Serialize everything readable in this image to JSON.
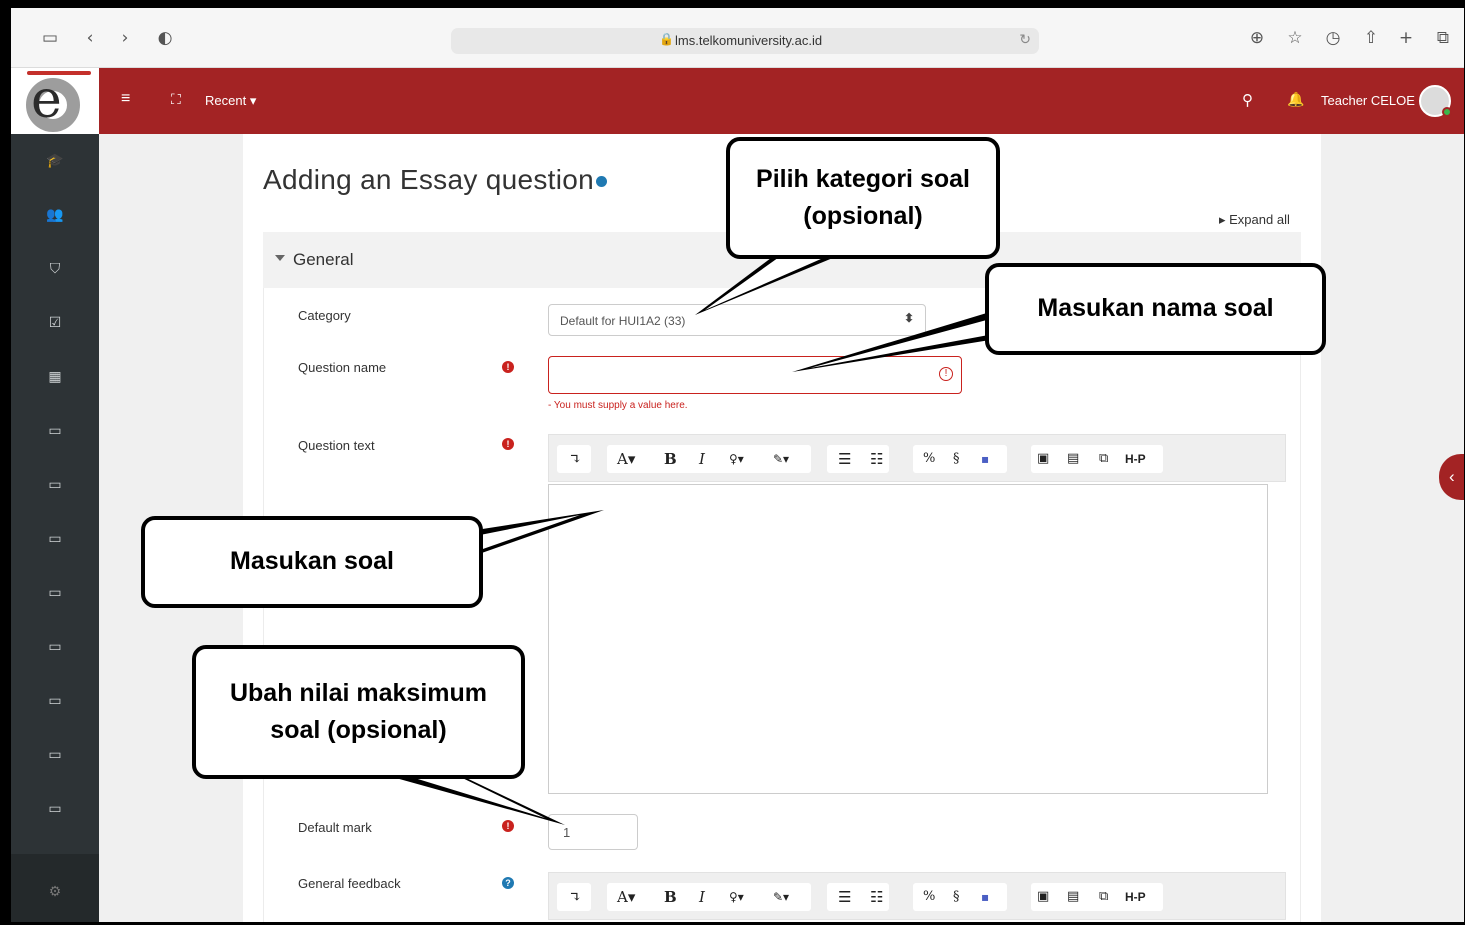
{
  "browser": {
    "url": "lms.telkomuniversity.ac.id",
    "icons": [
      "sidebar-icon",
      "back-icon",
      "forward-icon",
      "shield-icon",
      "download-icon",
      "star-icon",
      "history-icon",
      "share-icon",
      "new-tab-icon",
      "tabs-icon"
    ]
  },
  "navbar": {
    "recent_label": "Recent",
    "user_name": "Teacher CELOE",
    "color": "#a32324"
  },
  "sidebar": {
    "items": [
      "graduation-cap-icon",
      "users-icon",
      "shield-icon",
      "checkbox-icon",
      "grid-icon",
      "folder-icon",
      "folder-icon",
      "folder-icon",
      "folder-icon",
      "folder-icon",
      "folder-icon",
      "folder-icon",
      "folder-icon"
    ],
    "bottom_icon": "cogs-icon"
  },
  "page": {
    "title": "Adding an Essay question",
    "expand_all": "Expand all",
    "section": "General"
  },
  "form": {
    "category_label": "Category",
    "category_value": "Default for HUI1A2 (33)",
    "question_name_label": "Question name",
    "question_name_value": "",
    "question_name_error": "- You must supply a value here.",
    "question_text_label": "Question text",
    "default_mark_label": "Default mark",
    "default_mark_value": "1",
    "general_feedback_label": "General feedback"
  },
  "toolbar": {
    "bold": "B",
    "italic": "I",
    "font": "A",
    "h5p": "H-P"
  },
  "callouts": {
    "category": "Pilih kategori soal (opsional)",
    "question_name": "Masukan nama soal",
    "question_text": "Masukan soal",
    "default_mark": "Ubah nilai maksimum soal (opsional)"
  }
}
